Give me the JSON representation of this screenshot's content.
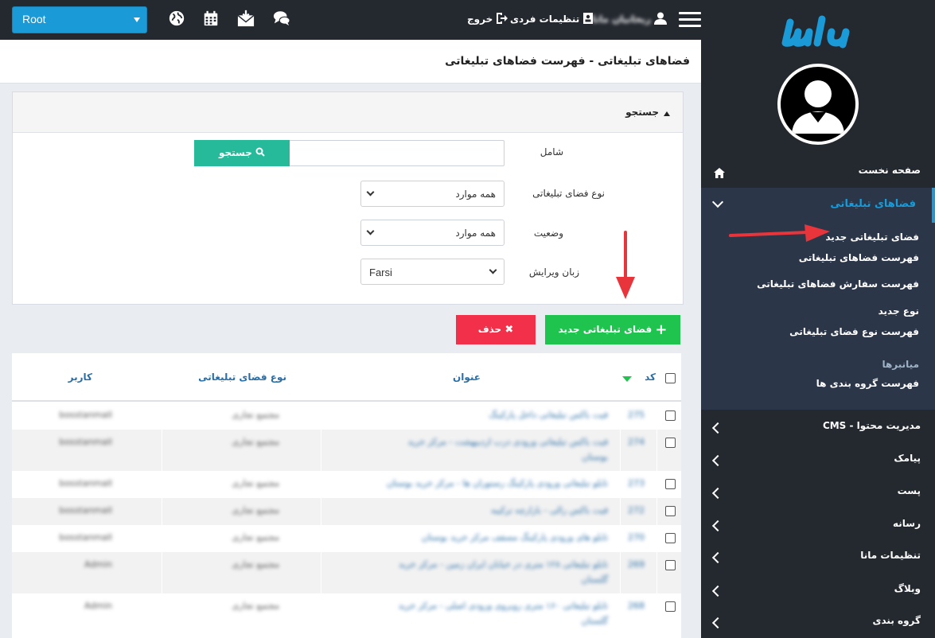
{
  "topbar": {
    "root_select": "Root",
    "logout": "خروج",
    "personal_settings": "تنظیمات فردی",
    "username": "ریحانیان مانا"
  },
  "page": {
    "title": "فضاهای تبلیغاتی - فهرست فضاهای تبلیغاتی"
  },
  "search": {
    "panel_title": "جستجو",
    "contains_label": "شامل",
    "contains_value": "",
    "search_button": "جستجو",
    "type_label": "نوع فضای تبلیغاتی",
    "type_value": "همه موارد",
    "status_label": "وضعیت",
    "status_value": "همه موارد",
    "language_label": "زبان ویرایش",
    "language_value": "Farsi"
  },
  "actions": {
    "new_label": "فضای تبلیغاتی جدید",
    "delete_label": "حذف"
  },
  "table": {
    "headers": {
      "code": "کد",
      "title": "عنوان",
      "type": "نوع فضای تبلیغاتی",
      "user": "کاربر"
    },
    "rows": [
      {
        "code": "275",
        "title": "فیت باکس تبلیغاتی داخل پارکینگ",
        "title2": "",
        "type": "مجتمع تجاری",
        "user": "bosstanmall"
      },
      {
        "code": "274",
        "title": "فیت باکس تبلیغاتی ورودی درب اردیبهشت - مرکز خرید",
        "title2": "بوستان",
        "type": "مجتمع تجاری",
        "user": "bosstanmall"
      },
      {
        "code": "273",
        "title": "تابلو تبلیغاتی ورودی پارکینگ رستوران ها - مرکز خرید بوستان",
        "title2": "",
        "type": "مجتمع تجاری",
        "user": "bosstanmall"
      },
      {
        "code": "272",
        "title": "فیت باکس رالی - بازارچه ترکیبه",
        "title2": "",
        "type": "مجتمع تجاری",
        "user": "bosstanmall"
      },
      {
        "code": "270",
        "title": "تابلو های ورودی پارکینگ مسقف مرکز خرید بوستان",
        "title2": "",
        "type": "مجتمع تجاری",
        "user": "bosstanmall"
      },
      {
        "code": "269",
        "title": "تابلو تبلیغاتی ۱۲۸ متری در خیابان ایران زمین - مرکز خرید",
        "title2": "گلستان",
        "type": "مجتمع تجاری",
        "user": "Admin"
      },
      {
        "code": "268",
        "title": "تابلو تبلیغاتی ۱۶۰ متری روبروی ورودی اصلی - مرکز خرید",
        "title2": "گلستان",
        "type": "مجتمع تجاری",
        "user": "Admin"
      }
    ]
  },
  "sidebar": {
    "home": "صفحه نخست",
    "ads_section": "فضاهای تبلیغاتی",
    "sub_items": [
      "فضای تبلیغاتی جدید",
      "فهرست فضاهای تبلیغاتی",
      "فهرست سفارش فضاهای تبلیغاتی",
      "نوع جدید",
      "فهرست نوع فضای تبلیغاتی"
    ],
    "group_label": "میانبرها",
    "group_item": "فهرست گروه بندی ها",
    "sections": [
      "مدیریت محتوا - CMS",
      "پیامک",
      "پست",
      "رسانه",
      "تنظیمات مانا",
      "وبلاگ",
      "گروه بندی"
    ]
  },
  "colors": {
    "accent": "#1a9bd8",
    "dark": "#24282f",
    "success": "#1fc44f",
    "danger": "#f33049",
    "teal": "#26b99a",
    "annotation_arrow": "#e8343b"
  }
}
